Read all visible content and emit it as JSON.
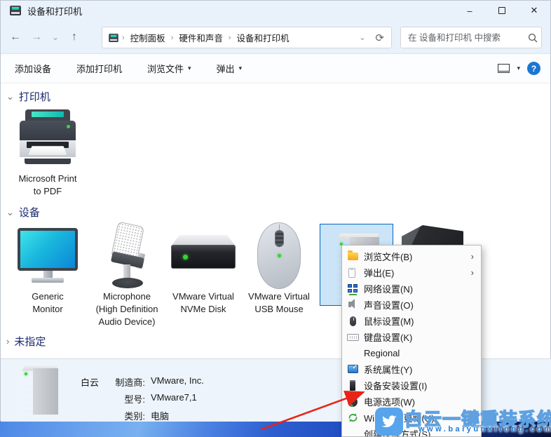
{
  "window": {
    "title": "设备和打印机"
  },
  "icons": {
    "back": "←",
    "forward": "→",
    "history": "⌄",
    "up": "↑",
    "refresh": "⟳",
    "addr_chevron": "⌄",
    "crumb_sep": "›",
    "dropdown": "▾",
    "submenu": "›",
    "section_open": "⌄",
    "section_closed": "›",
    "minimize": "–",
    "close": "✕",
    "help": "?"
  },
  "nav": {
    "crumbs": [
      "控制面板",
      "硬件和声音",
      "设备和打印机"
    ],
    "search_placeholder": "在 设备和打印机 中搜索"
  },
  "toolbar": {
    "add_device": "添加设备",
    "add_printer": "添加打印机",
    "browse_files": "浏览文件",
    "eject": "弹出"
  },
  "sections": {
    "printers": {
      "label": "打印机"
    },
    "devices": {
      "label": "设备"
    },
    "unspecified": {
      "label": "未指定"
    }
  },
  "printer_item": {
    "lines": [
      "Microsoft Print",
      "to PDF"
    ]
  },
  "device_items": [
    {
      "lines": [
        "Generic",
        "Monitor"
      ]
    },
    {
      "lines": [
        "Microphone",
        "(High Definition",
        "Audio Device)"
      ]
    },
    {
      "lines": [
        "VMware Virtual",
        "NVMe Disk"
      ]
    },
    {
      "lines": [
        "VMware Virtual",
        "USB Mouse"
      ]
    }
  ],
  "details": {
    "name": "白云",
    "rows": [
      {
        "label": "制造商:",
        "value": "VMware, Inc."
      },
      {
        "label": "型号:",
        "value": "VMware7,1"
      },
      {
        "label": "类别:",
        "value": "电脑"
      }
    ]
  },
  "context_menu": {
    "items": [
      {
        "label": "浏览文件(B)",
        "icon": "folder-icon",
        "submenu": true
      },
      {
        "label": "弹出(E)",
        "icon": "eject-icon",
        "submenu": true
      },
      {
        "label": "网络设置(N)",
        "icon": "network-icon",
        "submenu": false
      },
      {
        "label": "声音设置(O)",
        "icon": "speaker-icon",
        "submenu": false
      },
      {
        "label": "鼠标设置(M)",
        "icon": "mouse-icon",
        "submenu": false
      },
      {
        "label": "键盘设置(K)",
        "icon": "keyboard-icon",
        "submenu": false
      },
      {
        "label": "Regional",
        "icon": null,
        "submenu": false
      },
      {
        "label": "系统属性(Y)",
        "icon": "system-properties-icon",
        "submenu": false
      },
      {
        "label": "设备安装设置(I)",
        "icon": "device-install-icon",
        "submenu": false
      },
      {
        "label": "电源选项(W)",
        "icon": "power-options-icon",
        "submenu": false
      },
      {
        "label": "Windows 更新(U)",
        "icon": "windows-update-icon",
        "submenu": false
      },
      {
        "label": "创建快捷方式(S)",
        "icon": null,
        "submenu": false
      }
    ]
  },
  "watermark": {
    "title": "白云一键重装系统",
    "url": "www.baiyunxitong.com"
  },
  "colors": {
    "accent": "#0067c0",
    "selection_bg": "#cce4f7",
    "section_header": "#1b2a6e",
    "arrow_red": "#e8241a"
  }
}
